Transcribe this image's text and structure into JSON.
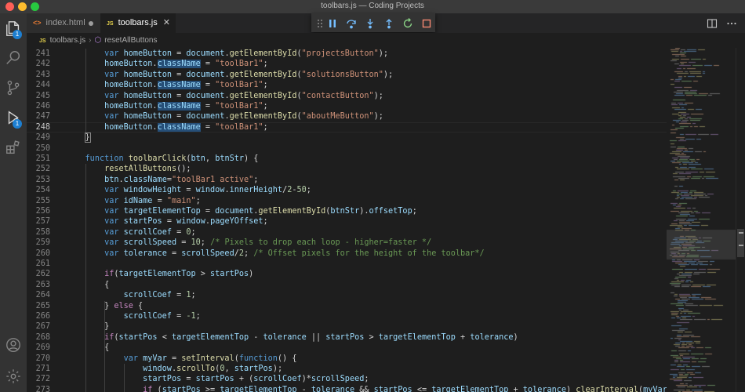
{
  "window": {
    "title": "toolbars.js — Coding Projects"
  },
  "activity_bar": {
    "explorer_badge": "1",
    "debug_badge": "1"
  },
  "tabs": [
    {
      "label": "index.html",
      "icon": "html-icon",
      "modified": true,
      "active": false
    },
    {
      "label": "toolbars.js",
      "icon": "js-file-icon",
      "modified": false,
      "active": true
    }
  ],
  "breadcrumb": {
    "file": "toolbars.js",
    "symbol": "resetAllButtons"
  },
  "editor": {
    "active_line": "248",
    "lines": [
      {
        "n": "241",
        "tokens": [
          [
            "pl",
            "        "
          ],
          [
            "kw",
            "var "
          ],
          [
            "var",
            "homeButton"
          ],
          [
            "pl",
            " = "
          ],
          [
            "var",
            "document"
          ],
          [
            "pl",
            "."
          ],
          [
            "fn",
            "getElementById"
          ],
          [
            "pl",
            "("
          ],
          [
            "str",
            "\"projectsButton\""
          ],
          [
            "pl",
            ");"
          ]
        ]
      },
      {
        "n": "242",
        "tokens": [
          [
            "pl",
            "        "
          ],
          [
            "var",
            "homeButton"
          ],
          [
            "pl",
            "."
          ],
          [
            "hlvar",
            "className"
          ],
          [
            "pl",
            " = "
          ],
          [
            "str",
            "\"toolBar1\""
          ],
          [
            "pl",
            ";"
          ]
        ]
      },
      {
        "n": "243",
        "tokens": [
          [
            "pl",
            "        "
          ],
          [
            "kw",
            "var "
          ],
          [
            "var",
            "homeButton"
          ],
          [
            "pl",
            " = "
          ],
          [
            "var",
            "document"
          ],
          [
            "pl",
            "."
          ],
          [
            "fn",
            "getElementById"
          ],
          [
            "pl",
            "("
          ],
          [
            "str",
            "\"solutionsButton\""
          ],
          [
            "pl",
            ");"
          ]
        ]
      },
      {
        "n": "244",
        "tokens": [
          [
            "pl",
            "        "
          ],
          [
            "var",
            "homeButton"
          ],
          [
            "pl",
            "."
          ],
          [
            "hlvar",
            "className"
          ],
          [
            "pl",
            " = "
          ],
          [
            "str",
            "\"toolBar1\""
          ],
          [
            "pl",
            ";"
          ]
        ]
      },
      {
        "n": "245",
        "tokens": [
          [
            "pl",
            "        "
          ],
          [
            "kw",
            "var "
          ],
          [
            "var",
            "homeButton"
          ],
          [
            "pl",
            " = "
          ],
          [
            "var",
            "document"
          ],
          [
            "pl",
            "."
          ],
          [
            "fn",
            "getElementById"
          ],
          [
            "pl",
            "("
          ],
          [
            "str",
            "\"contactButton\""
          ],
          [
            "pl",
            ");"
          ]
        ]
      },
      {
        "n": "246",
        "tokens": [
          [
            "pl",
            "        "
          ],
          [
            "var",
            "homeButton"
          ],
          [
            "pl",
            "."
          ],
          [
            "hlvar",
            "className"
          ],
          [
            "pl",
            " = "
          ],
          [
            "str",
            "\"toolBar1\""
          ],
          [
            "pl",
            ";"
          ]
        ]
      },
      {
        "n": "247",
        "tokens": [
          [
            "pl",
            "        "
          ],
          [
            "kw",
            "var "
          ],
          [
            "var",
            "homeButton"
          ],
          [
            "pl",
            " = "
          ],
          [
            "var",
            "document"
          ],
          [
            "pl",
            "."
          ],
          [
            "fn",
            "getElementById"
          ],
          [
            "pl",
            "("
          ],
          [
            "str",
            "\"aboutMeButton\""
          ],
          [
            "pl",
            ");"
          ]
        ]
      },
      {
        "n": "248",
        "tokens": [
          [
            "pl",
            "        "
          ],
          [
            "var",
            "homeButton"
          ],
          [
            "pl",
            "."
          ],
          [
            "hlvar",
            "className"
          ],
          [
            "pl",
            " = "
          ],
          [
            "str",
            "\"toolBar1\""
          ],
          [
            "pl",
            ";"
          ]
        ]
      },
      {
        "n": "249",
        "tokens": [
          [
            "pl",
            "    "
          ],
          [
            "box",
            "}"
          ]
        ]
      },
      {
        "n": "250",
        "tokens": []
      },
      {
        "n": "251",
        "tokens": [
          [
            "pl",
            "    "
          ],
          [
            "kw",
            "function "
          ],
          [
            "fn",
            "toolbarClick"
          ],
          [
            "pl",
            "("
          ],
          [
            "var",
            "btn"
          ],
          [
            "pl",
            ", "
          ],
          [
            "var",
            "btnStr"
          ],
          [
            "pl",
            ") {"
          ]
        ]
      },
      {
        "n": "252",
        "tokens": [
          [
            "pl",
            "        "
          ],
          [
            "fn",
            "resetAllButtons"
          ],
          [
            "pl",
            "();"
          ]
        ]
      },
      {
        "n": "253",
        "tokens": [
          [
            "pl",
            "        "
          ],
          [
            "var",
            "btn"
          ],
          [
            "pl",
            "."
          ],
          [
            "var",
            "className"
          ],
          [
            "pl",
            "="
          ],
          [
            "str",
            "\"toolBar1 active\""
          ],
          [
            "pl",
            ";"
          ]
        ]
      },
      {
        "n": "254",
        "tokens": [
          [
            "pl",
            "        "
          ],
          [
            "kw",
            "var "
          ],
          [
            "var",
            "windowHeight"
          ],
          [
            "pl",
            " = "
          ],
          [
            "var",
            "window"
          ],
          [
            "pl",
            "."
          ],
          [
            "var",
            "innerHeight"
          ],
          [
            "pl",
            "/"
          ],
          [
            "num",
            "2"
          ],
          [
            "pl",
            "-"
          ],
          [
            "num",
            "50"
          ],
          [
            "pl",
            ";"
          ]
        ]
      },
      {
        "n": "255",
        "tokens": [
          [
            "pl",
            "        "
          ],
          [
            "kw",
            "var "
          ],
          [
            "var",
            "idName"
          ],
          [
            "pl",
            " = "
          ],
          [
            "str",
            "\"main\""
          ],
          [
            "pl",
            ";"
          ]
        ]
      },
      {
        "n": "256",
        "tokens": [
          [
            "pl",
            "        "
          ],
          [
            "kw",
            "var "
          ],
          [
            "var",
            "targetElementTop"
          ],
          [
            "pl",
            " = "
          ],
          [
            "var",
            "document"
          ],
          [
            "pl",
            "."
          ],
          [
            "fn",
            "getElementById"
          ],
          [
            "pl",
            "("
          ],
          [
            "var",
            "btnStr"
          ],
          [
            "pl",
            ")."
          ],
          [
            "var",
            "offsetTop"
          ],
          [
            "pl",
            ";"
          ]
        ]
      },
      {
        "n": "257",
        "tokens": [
          [
            "pl",
            "        "
          ],
          [
            "kw",
            "var "
          ],
          [
            "var",
            "startPos"
          ],
          [
            "pl",
            " = "
          ],
          [
            "var",
            "window"
          ],
          [
            "pl",
            "."
          ],
          [
            "var",
            "pageYOffset"
          ],
          [
            "pl",
            ";"
          ]
        ]
      },
      {
        "n": "258",
        "tokens": [
          [
            "pl",
            "        "
          ],
          [
            "kw",
            "var "
          ],
          [
            "var",
            "scrollCoef"
          ],
          [
            "pl",
            " = "
          ],
          [
            "num",
            "0"
          ],
          [
            "pl",
            ";"
          ]
        ]
      },
      {
        "n": "259",
        "tokens": [
          [
            "pl",
            "        "
          ],
          [
            "kw",
            "var "
          ],
          [
            "var",
            "scrollSpeed"
          ],
          [
            "pl",
            " = "
          ],
          [
            "num",
            "10"
          ],
          [
            "pl",
            "; "
          ],
          [
            "com",
            "/* Pixels to drop each loop - higher=faster */"
          ]
        ]
      },
      {
        "n": "260",
        "tokens": [
          [
            "pl",
            "        "
          ],
          [
            "kw",
            "var "
          ],
          [
            "var",
            "tolerance"
          ],
          [
            "pl",
            " = "
          ],
          [
            "var",
            "scrollSpeed"
          ],
          [
            "pl",
            "/"
          ],
          [
            "num",
            "2"
          ],
          [
            "pl",
            "; "
          ],
          [
            "com",
            "/* Offset pixels for the height of the toolbar*/"
          ]
        ]
      },
      {
        "n": "261",
        "tokens": []
      },
      {
        "n": "262",
        "tokens": [
          [
            "pl",
            "        "
          ],
          [
            "ctl",
            "if"
          ],
          [
            "pl",
            "("
          ],
          [
            "var",
            "targetElementTop"
          ],
          [
            "pl",
            " > "
          ],
          [
            "var",
            "startPos"
          ],
          [
            "pl",
            ")"
          ]
        ]
      },
      {
        "n": "263",
        "tokens": [
          [
            "pl",
            "        {"
          ]
        ]
      },
      {
        "n": "264",
        "tokens": [
          [
            "pl",
            "            "
          ],
          [
            "var",
            "scrollCoef"
          ],
          [
            "pl",
            " = "
          ],
          [
            "num",
            "1"
          ],
          [
            "pl",
            ";"
          ]
        ]
      },
      {
        "n": "265",
        "tokens": [
          [
            "pl",
            "        } "
          ],
          [
            "ctl",
            "else"
          ],
          [
            "pl",
            " {"
          ]
        ]
      },
      {
        "n": "266",
        "tokens": [
          [
            "pl",
            "            "
          ],
          [
            "var",
            "scrollCoef"
          ],
          [
            "pl",
            " = "
          ],
          [
            "num",
            "-1"
          ],
          [
            "pl",
            ";"
          ]
        ]
      },
      {
        "n": "267",
        "tokens": [
          [
            "pl",
            "        }"
          ]
        ]
      },
      {
        "n": "268",
        "tokens": [
          [
            "pl",
            "        "
          ],
          [
            "ctl",
            "if"
          ],
          [
            "pl",
            "("
          ],
          [
            "var",
            "startPos"
          ],
          [
            "pl",
            " < "
          ],
          [
            "var",
            "targetElementTop"
          ],
          [
            "pl",
            " - "
          ],
          [
            "var",
            "tolerance"
          ],
          [
            "pl",
            " || "
          ],
          [
            "var",
            "startPos"
          ],
          [
            "pl",
            " > "
          ],
          [
            "var",
            "targetElementTop"
          ],
          [
            "pl",
            " + "
          ],
          [
            "var",
            "tolerance"
          ],
          [
            "pl",
            ")"
          ]
        ]
      },
      {
        "n": "269",
        "tokens": [
          [
            "pl",
            "        {"
          ]
        ]
      },
      {
        "n": "270",
        "tokens": [
          [
            "pl",
            "            "
          ],
          [
            "kw",
            "var "
          ],
          [
            "var",
            "myVar"
          ],
          [
            "pl",
            " = "
          ],
          [
            "fn",
            "setInterval"
          ],
          [
            "pl",
            "("
          ],
          [
            "kw",
            "function"
          ],
          [
            "pl",
            "() {"
          ]
        ]
      },
      {
        "n": "271",
        "tokens": [
          [
            "pl",
            "                "
          ],
          [
            "var",
            "window"
          ],
          [
            "pl",
            "."
          ],
          [
            "fn",
            "scrollTo"
          ],
          [
            "pl",
            "("
          ],
          [
            "num",
            "0"
          ],
          [
            "pl",
            ", "
          ],
          [
            "var",
            "startPos"
          ],
          [
            "pl",
            ");"
          ]
        ]
      },
      {
        "n": "272",
        "tokens": [
          [
            "pl",
            "                "
          ],
          [
            "var",
            "startPos"
          ],
          [
            "pl",
            " = "
          ],
          [
            "var",
            "startPos"
          ],
          [
            "pl",
            " + ("
          ],
          [
            "var",
            "scrollCoef"
          ],
          [
            "pl",
            ")*"
          ],
          [
            "var",
            "scrollSpeed"
          ],
          [
            "pl",
            ";"
          ]
        ]
      },
      {
        "n": "273",
        "tokens": [
          [
            "pl",
            "                "
          ],
          [
            "ctl",
            "if"
          ],
          [
            "pl",
            " ("
          ],
          [
            "var",
            "startPos"
          ],
          [
            "pl",
            " >= "
          ],
          [
            "var",
            "targetElementTop"
          ],
          [
            "pl",
            " - "
          ],
          [
            "var",
            "tolerance"
          ],
          [
            "pl",
            " && "
          ],
          [
            "var",
            "startPos"
          ],
          [
            "pl",
            " <= "
          ],
          [
            "var",
            "targetElementTop"
          ],
          [
            "pl",
            " + "
          ],
          [
            "var",
            "tolerance"
          ],
          [
            "pl",
            ") "
          ],
          [
            "fn",
            "clearInterval"
          ],
          [
            "pl",
            "("
          ],
          [
            "var",
            "myVar"
          ],
          [
            "pl",
            ");"
          ]
        ]
      }
    ]
  },
  "colors": {
    "background": "#1e1e1e",
    "activity_bar": "#333333",
    "tab_bar": "#252526",
    "accent": "#1d7fd1",
    "debug_continue": "#75beff",
    "debug_restart": "#89d185",
    "debug_stop": "#f48771"
  }
}
